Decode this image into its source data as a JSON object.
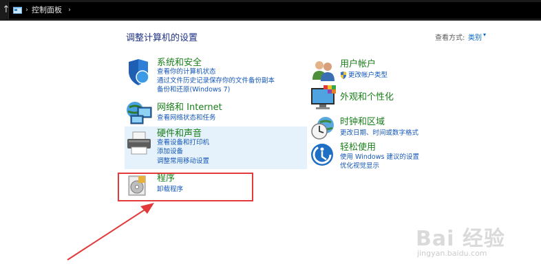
{
  "address_bar": {
    "breadcrumb": "控制面板",
    "up_icon": "up-arrow-icon",
    "folder_icon": "control-panel-folder-icon"
  },
  "header": {
    "title": "调整计算机的设置",
    "view_by_label": "查看方式:",
    "view_by_value": "类别"
  },
  "categories_left": [
    {
      "title": "系统和安全",
      "icon": "shield-icon",
      "links": [
        "查看你的计算机状态",
        "通过文件历史记录保存你的文件备份副本",
        "备份和还原(Windows 7)"
      ]
    },
    {
      "title": "网络和 Internet",
      "icon": "network-globe-icon",
      "links": [
        "查看网络状态和任务"
      ]
    },
    {
      "title": "硬件和声音",
      "icon": "printer-icon",
      "links": [
        "查看设备和打印机",
        "添加设备",
        "调整常用移动设置"
      ]
    },
    {
      "title": "程序",
      "icon": "programs-disc-icon",
      "links": [
        "卸载程序"
      ]
    }
  ],
  "categories_right": [
    {
      "title": "用户帐户",
      "icon": "users-icon",
      "links": [
        "更改帐户类型"
      ]
    },
    {
      "title": "外观和个性化",
      "icon": "monitor-palette-icon",
      "links": []
    },
    {
      "title": "时钟和区域",
      "icon": "clock-globe-icon",
      "links": [
        "更改日期、时间或数字格式"
      ]
    },
    {
      "title": "轻松使用",
      "icon": "ease-of-access-icon",
      "links": [
        "使用 Windows 建议的设置",
        "优化视觉显示"
      ]
    }
  ],
  "watermark": {
    "text": "Bai 经验",
    "sub": "jingyan.baidu.com"
  },
  "colors": {
    "title_green": "#1a7f1a",
    "link_blue": "#1457b8",
    "annotation_red": "#e23a3a"
  }
}
